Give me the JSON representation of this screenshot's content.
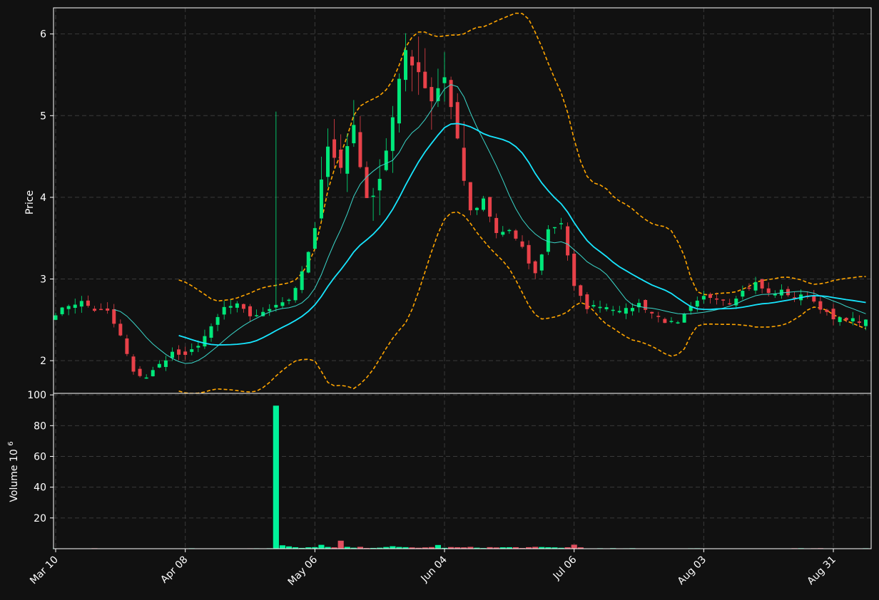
{
  "chart_data": {
    "type": "candlestick",
    "colors": {
      "background": "#111111",
      "up": "#00e87a",
      "down": "#e84149",
      "volume_up": "#00f29a",
      "volume_down": "#e04f5f",
      "ma_fast": "#3ad6c9",
      "ma_slow": "#17e6ff",
      "bollinger": "#ffa500",
      "grid": "#3a3a3a",
      "axis": "#ffffff"
    },
    "price_panel": {
      "ylabel": "Price",
      "ylim": [
        1.6,
        6.32
      ],
      "yticks": [
        "2",
        "3",
        "4",
        "5",
        "6"
      ],
      "grid": true
    },
    "volume_panel": {
      "ylabel": "Volume",
      "ylabel_exp": "10",
      "ylabel_sup": "6",
      "ylim": [
        0,
        101
      ],
      "yticks": [
        "20",
        "40",
        "60",
        "80",
        "100"
      ]
    },
    "x_ticks": [
      {
        "label": "Mar 10",
        "index": 0
      },
      {
        "label": "Apr 08",
        "index": 20
      },
      {
        "label": "May 06",
        "index": 40
      },
      {
        "label": "Jun 04",
        "index": 60
      },
      {
        "label": "Jul 06",
        "index": 80
      },
      {
        "label": "Aug 03",
        "index": 100
      },
      {
        "label": "Aug 31",
        "index": 120
      }
    ],
    "price_anchors": [
      [
        0,
        2.58
      ],
      [
        2,
        2.68
      ],
      [
        4,
        2.72
      ],
      [
        6,
        2.62
      ],
      [
        8,
        2.6
      ],
      [
        10,
        2.3
      ],
      [
        12,
        1.85
      ],
      [
        14,
        1.8
      ],
      [
        16,
        1.95
      ],
      [
        18,
        2.1
      ],
      [
        20,
        2.05
      ],
      [
        22,
        2.2
      ],
      [
        24,
        2.4
      ],
      [
        26,
        2.65
      ],
      [
        28,
        2.68
      ],
      [
        30,
        2.55
      ],
      [
        32,
        2.58
      ],
      [
        34,
        2.7
      ],
      [
        36,
        2.75
      ],
      [
        38,
        3.05
      ],
      [
        40,
        3.6
      ],
      [
        42,
        4.7
      ],
      [
        44,
        4.35
      ],
      [
        46,
        4.9
      ],
      [
        48,
        3.95
      ],
      [
        50,
        4.25
      ],
      [
        52,
        4.95
      ],
      [
        54,
        5.8
      ],
      [
        56,
        5.55
      ],
      [
        58,
        5.2
      ],
      [
        60,
        5.5
      ],
      [
        62,
        4.7
      ],
      [
        64,
        3.8
      ],
      [
        66,
        3.95
      ],
      [
        68,
        3.55
      ],
      [
        70,
        3.6
      ],
      [
        72,
        3.35
      ],
      [
        74,
        3.05
      ],
      [
        76,
        3.6
      ],
      [
        78,
        3.7
      ],
      [
        80,
        2.9
      ],
      [
        82,
        2.65
      ],
      [
        84,
        2.68
      ],
      [
        86,
        2.64
      ],
      [
        88,
        2.62
      ],
      [
        90,
        2.7
      ],
      [
        92,
        2.58
      ],
      [
        94,
        2.48
      ],
      [
        96,
        2.45
      ],
      [
        98,
        2.65
      ],
      [
        100,
        2.78
      ],
      [
        102,
        2.78
      ],
      [
        104,
        2.72
      ],
      [
        106,
        2.85
      ],
      [
        108,
        2.95
      ],
      [
        110,
        2.82
      ],
      [
        112,
        2.85
      ],
      [
        114,
        2.78
      ],
      [
        116,
        2.8
      ],
      [
        118,
        2.65
      ],
      [
        120,
        2.5
      ],
      [
        122,
        2.52
      ],
      [
        124,
        2.48
      ]
    ],
    "volume_spikes": [
      {
        "index": 34,
        "value": 93
      },
      {
        "index": 35,
        "value": 2.2
      },
      {
        "index": 36,
        "value": 1.5
      },
      {
        "index": 41,
        "value": 2.5
      },
      {
        "index": 44,
        "value": 5.2
      },
      {
        "index": 52,
        "value": 1.6
      },
      {
        "index": 59,
        "value": 2.4
      },
      {
        "index": 80,
        "value": 2.6
      }
    ],
    "ma_periods": [
      5,
      20
    ],
    "bollinger_period": 20,
    "n_bars": 126
  }
}
